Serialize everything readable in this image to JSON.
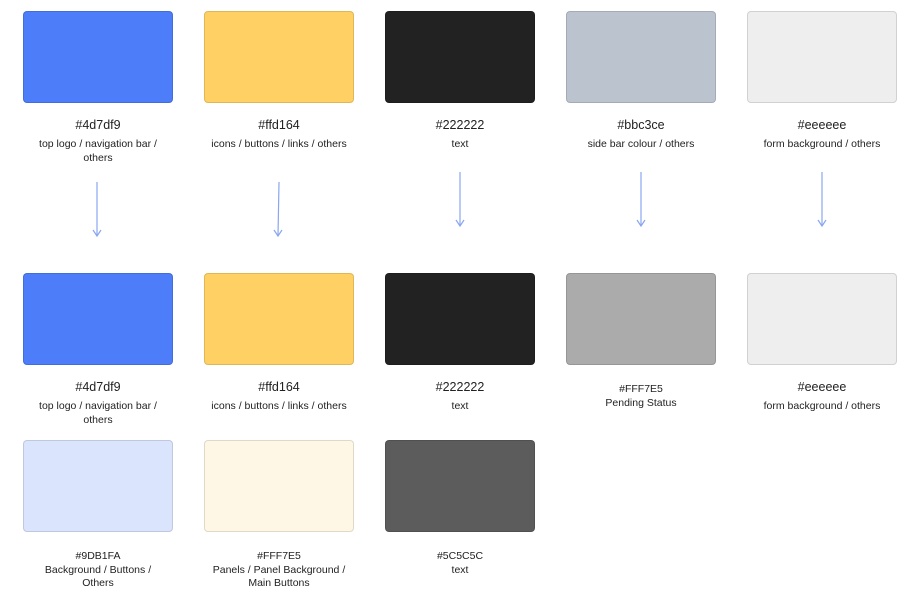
{
  "top_row": [
    {
      "color": "#4d7df9",
      "hex": "#4d7df9",
      "desc": "top logo / navigation bar / others"
    },
    {
      "color": "#ffd164",
      "hex": "#ffd164",
      "desc": "icons / buttons / links / others"
    },
    {
      "color": "#222222",
      "hex": "#222222",
      "desc": "text"
    },
    {
      "color": "#bbc3ce",
      "hex": "#bbc3ce",
      "desc": "side bar colour / others"
    },
    {
      "color": "#eeeeee",
      "hex": "#eeeeee",
      "desc": "form background / others"
    }
  ],
  "middle_row": [
    {
      "color": "#4d7df9",
      "hex": "#4d7df9",
      "desc": "top logo / navigation bar / others"
    },
    {
      "color": "#ffd164",
      "hex": "#ffd164",
      "desc": "icons / buttons / links / others"
    },
    {
      "color": "#222222",
      "hex": "#222222",
      "desc": "text"
    },
    {
      "color": "#ababab",
      "hex": "#FFF7E5",
      "desc": "Pending Status"
    },
    {
      "color": "#eeeeee",
      "hex": "#eeeeee",
      "desc": "form background / others"
    }
  ],
  "bottom_row": [
    {
      "color": "#dbe4fd",
      "hex": "#9DB1FA",
      "desc": "Background / Buttons / Others"
    },
    {
      "color": "#fff7e5",
      "hex": "#FFF7E5",
      "desc": "Panels / Panel Background / Main Buttons"
    },
    {
      "color": "#5c5c5c",
      "hex": "#5C5C5C",
      "desc": "text"
    }
  ],
  "arrow_color": "#8aa6f0"
}
